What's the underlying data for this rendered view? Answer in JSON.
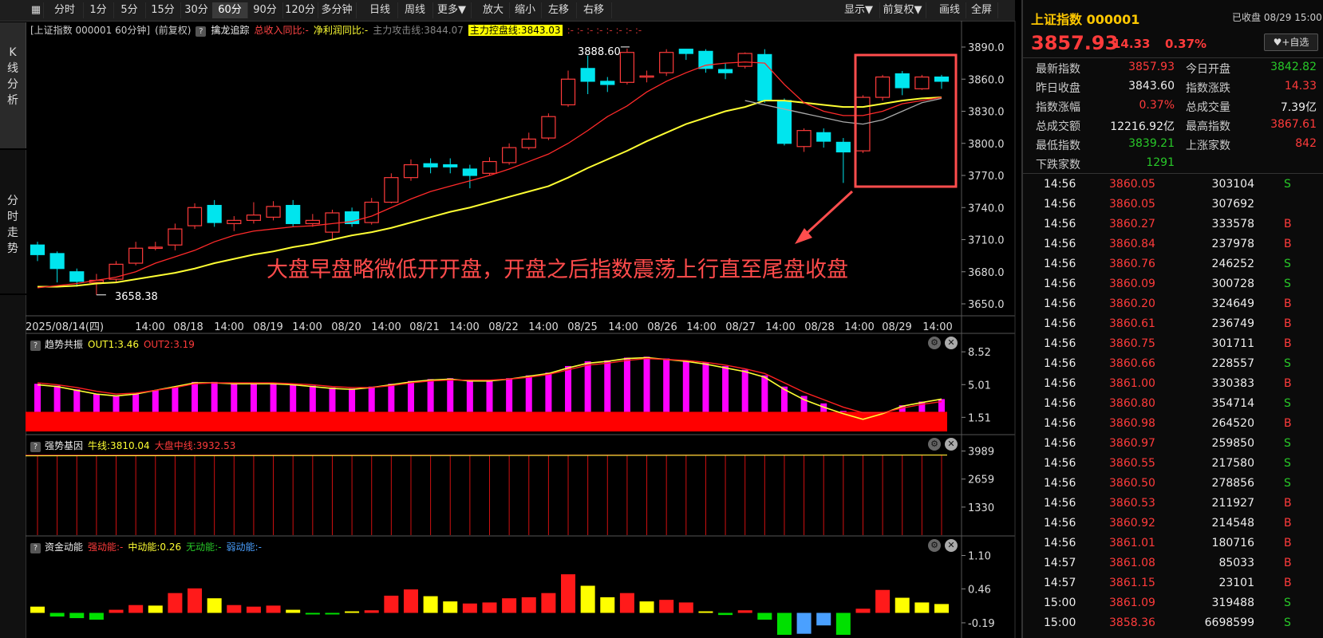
{
  "toolbar": {
    "buttons": [
      "分时",
      "1分",
      "5分",
      "15分",
      "30分",
      "60分",
      "90分",
      "120分",
      "多分钟",
      "日线",
      "周线",
      "更多▼",
      "放大",
      "缩小",
      "左移",
      "右移"
    ],
    "active": "60分",
    "right_buttons": [
      "显示▼",
      "前复权▼",
      "画线",
      "全屏"
    ]
  },
  "left_tabs": {
    "kline": [
      "K",
      "线",
      "分",
      "析"
    ],
    "timeshare": [
      "分",
      "时",
      "走",
      "势"
    ]
  },
  "main_info": {
    "title": "[上证指数 000001 60分钟]",
    "adjust": "(前复权)",
    "indicator": "擒龙追踪",
    "rev_yoy": "总收入同比:-",
    "profit_yoy": "净利润同比:-",
    "attack_line": "主力攻击线:3844.07",
    "control_line": "主力控盘线:3843.03",
    "dashes": ":- :- :- :- :- :- :- :-"
  },
  "price_axis": [
    "3890.0",
    "3860.0",
    "3830.0",
    "3800.0",
    "3770.0",
    "3740.0",
    "3710.0",
    "3680.0",
    "3650.0"
  ],
  "time_axis": [
    "2025/08/14(四)",
    "14:00",
    "08/18",
    "14:00",
    "08/19",
    "14:00",
    "08/20",
    "14:00",
    "08/21",
    "14:00",
    "08/22",
    "14:00",
    "08/25",
    "14:00",
    "08/26",
    "14:00",
    "08/27",
    "14:00",
    "08/28",
    "14:00",
    "08/29",
    "14:00"
  ],
  "annotations": {
    "high_label": "3888.60",
    "low_label": "3658.38",
    "comment": "大盘早盘略微低开开盘，开盘之后指数震荡上行直至尾盘收盘"
  },
  "candles": [
    {
      "o": 3705,
      "c": 3696,
      "h": 3708,
      "l": 3690
    },
    {
      "o": 3697,
      "c": 3683,
      "h": 3699,
      "l": 3670
    },
    {
      "o": 3680,
      "c": 3671,
      "h": 3683,
      "l": 3666
    },
    {
      "o": 3670,
      "c": 3672,
      "h": 3678,
      "l": 3658.38
    },
    {
      "o": 3673,
      "c": 3687,
      "h": 3690,
      "l": 3670
    },
    {
      "o": 3688,
      "c": 3702,
      "h": 3708,
      "l": 3686
    },
    {
      "o": 3702,
      "c": 3703,
      "h": 3708,
      "l": 3700
    },
    {
      "o": 3705,
      "c": 3720,
      "h": 3725,
      "l": 3700
    },
    {
      "o": 3723,
      "c": 3740,
      "h": 3744,
      "l": 3720
    },
    {
      "o": 3742,
      "c": 3726,
      "h": 3747,
      "l": 3722
    },
    {
      "o": 3725,
      "c": 3728,
      "h": 3732,
      "l": 3718
    },
    {
      "o": 3728,
      "c": 3733,
      "h": 3745,
      "l": 3725
    },
    {
      "o": 3731,
      "c": 3741,
      "h": 3746,
      "l": 3728
    },
    {
      "o": 3742,
      "c": 3725,
      "h": 3747,
      "l": 3722
    },
    {
      "o": 3725,
      "c": 3728,
      "h": 3734,
      "l": 3722
    },
    {
      "o": 3717,
      "c": 3735,
      "h": 3738,
      "l": 3710
    },
    {
      "o": 3736,
      "c": 3725,
      "h": 3740,
      "l": 3722
    },
    {
      "o": 3726,
      "c": 3745,
      "h": 3749,
      "l": 3724
    },
    {
      "o": 3745,
      "c": 3768,
      "h": 3772,
      "l": 3744
    },
    {
      "o": 3768,
      "c": 3780,
      "h": 3785,
      "l": 3765
    },
    {
      "o": 3781,
      "c": 3778,
      "h": 3786,
      "l": 3772
    },
    {
      "o": 3780,
      "c": 3778,
      "h": 3786,
      "l": 3772
    },
    {
      "o": 3776,
      "c": 3770,
      "h": 3780,
      "l": 3758
    },
    {
      "o": 3772,
      "c": 3783,
      "h": 3787,
      "l": 3770
    },
    {
      "o": 3782,
      "c": 3796,
      "h": 3800,
      "l": 3780
    },
    {
      "o": 3796,
      "c": 3804,
      "h": 3810,
      "l": 3794
    },
    {
      "o": 3805,
      "c": 3825,
      "h": 3828,
      "l": 3803
    },
    {
      "o": 3836,
      "c": 3860,
      "h": 3868,
      "l": 3834
    },
    {
      "o": 3870,
      "c": 3858,
      "h": 3882,
      "l": 3846
    },
    {
      "o": 3858,
      "c": 3855,
      "h": 3862,
      "l": 3848
    },
    {
      "o": 3857,
      "c": 3885,
      "h": 3888.6,
      "l": 3855
    },
    {
      "o": 3863,
      "c": 3863,
      "h": 3868,
      "l": 3857
    },
    {
      "o": 3866,
      "c": 3885,
      "h": 3888,
      "l": 3863
    },
    {
      "o": 3888,
      "c": 3884,
      "h": 3888,
      "l": 3878
    },
    {
      "o": 3886,
      "c": 3870,
      "h": 3888,
      "l": 3866
    },
    {
      "o": 3869,
      "c": 3866,
      "h": 3875,
      "l": 3860
    },
    {
      "o": 3872,
      "c": 3884,
      "h": 3885,
      "l": 3870
    },
    {
      "o": 3883,
      "c": 3840,
      "h": 3888,
      "l": 3838
    },
    {
      "o": 3840,
      "c": 3800,
      "h": 3842,
      "l": 3798
    },
    {
      "o": 3797,
      "c": 3812,
      "h": 3814,
      "l": 3792
    },
    {
      "o": 3810,
      "c": 3802,
      "h": 3814,
      "l": 3796
    },
    {
      "o": 3801,
      "c": 3792,
      "h": 3805,
      "l": 3763
    },
    {
      "o": 3793,
      "c": 3843,
      "h": 3845,
      "l": 3791
    },
    {
      "o": 3843,
      "c": 3862,
      "h": 3864,
      "l": 3840
    },
    {
      "o": 3865,
      "c": 3852,
      "h": 3867.61,
      "l": 3845
    },
    {
      "o": 3851,
      "c": 3862,
      "h": 3864,
      "l": 3850
    },
    {
      "o": 3862,
      "c": 3858,
      "h": 3864,
      "l": 3851
    }
  ],
  "ma_red": [
    3665,
    3667,
    3669,
    3672,
    3675,
    3680,
    3688,
    3694,
    3700,
    3708,
    3714,
    3718,
    3720,
    3722,
    3723,
    3725,
    3727,
    3732,
    3740,
    3748,
    3755,
    3760,
    3765,
    3770,
    3776,
    3783,
    3790,
    3800,
    3812,
    3825,
    3835,
    3848,
    3858,
    3866,
    3873,
    3875,
    3876,
    3875,
    3855,
    3838,
    3830,
    3826,
    3826,
    3830,
    3837,
    3840,
    3843
  ],
  "ma_yellow": [
    3666,
    3666,
    3667,
    3669,
    3670,
    3673,
    3676,
    3679,
    3683,
    3688,
    3692,
    3696,
    3699,
    3703,
    3706,
    3710,
    3714,
    3717,
    3721,
    3726,
    3731,
    3736,
    3740,
    3745,
    3750,
    3755,
    3760,
    3768,
    3777,
    3785,
    3793,
    3802,
    3810,
    3818,
    3824,
    3830,
    3834,
    3840,
    3840,
    3838,
    3836,
    3834,
    3834,
    3837,
    3840,
    3842,
    3843
  ],
  "ma_grey": [
    3840,
    3836,
    3832,
    3828,
    3824,
    3820,
    3818,
    3822,
    3830,
    3838,
    3842
  ],
  "sub1": {
    "title": "趋势共振",
    "out1": "OUT1:3.46",
    "out2": "OUT2:3.19",
    "axis": [
      "8.52",
      "5.01",
      "1.51"
    ],
    "bars": [
      5.1,
      4.9,
      4.5,
      4.0,
      3.8,
      4.0,
      4.4,
      4.8,
      5.3,
      5.3,
      5.2,
      5.2,
      5.2,
      5.1,
      4.9,
      4.7,
      4.6,
      4.8,
      5.1,
      5.4,
      5.6,
      5.7,
      5.5,
      5.5,
      5.7,
      6.0,
      6.3,
      7.0,
      7.5,
      7.6,
      7.9,
      8.0,
      7.8,
      7.6,
      7.4,
      7.0,
      6.6,
      6.0,
      4.8,
      3.8,
      3.0,
      2.2,
      1.7,
      1.8,
      2.8,
      3.2,
      3.46
    ],
    "out1_line": [
      5.0,
      4.8,
      4.4,
      4.0,
      3.8,
      4.0,
      4.4,
      4.8,
      5.2,
      5.2,
      5.1,
      5.1,
      5.1,
      5.0,
      4.8,
      4.6,
      4.5,
      4.7,
      5.0,
      5.3,
      5.5,
      5.6,
      5.4,
      5.4,
      5.6,
      5.9,
      6.2,
      6.8,
      7.3,
      7.5,
      7.8,
      7.9,
      7.7,
      7.5,
      7.2,
      6.8,
      6.4,
      5.8,
      4.5,
      3.4,
      2.6,
      1.9,
      1.3,
      1.9,
      2.7,
      3.1,
      3.46
    ],
    "out2_line": [
      5.2,
      5.0,
      4.7,
      4.3,
      4.0,
      4.1,
      4.4,
      4.7,
      5.1,
      5.2,
      5.2,
      5.2,
      5.2,
      5.1,
      5.0,
      4.8,
      4.7,
      4.7,
      4.9,
      5.2,
      5.4,
      5.5,
      5.5,
      5.5,
      5.6,
      5.8,
      6.1,
      6.6,
      7.1,
      7.3,
      7.6,
      7.8,
      7.7,
      7.6,
      7.4,
      7.1,
      6.7,
      6.2,
      5.2,
      4.2,
      3.4,
      2.6,
      2.0,
      2.0,
      2.5,
      2.9,
      3.19
    ]
  },
  "sub2": {
    "title": "强势基因",
    "bull": "牛线:3810.04",
    "mid": "大盘中线:3932.53",
    "axis": [
      "3989",
      "2659",
      "1330"
    ]
  },
  "sub3": {
    "title": "资金动能",
    "strong": "强动能:-",
    "medium": "中动能:0.26",
    "none": "无动能:-",
    "weak": "弱动能:-",
    "axis": [
      "1.10",
      "0.46",
      "-0.19"
    ],
    "bars": [
      {
        "v": 0.12,
        "c": "y"
      },
      {
        "v": -0.07,
        "c": "g"
      },
      {
        "v": -0.1,
        "c": "g"
      },
      {
        "v": -0.13,
        "c": "g"
      },
      {
        "v": 0.06,
        "c": "r"
      },
      {
        "v": 0.15,
        "c": "r"
      },
      {
        "v": 0.14,
        "c": "y"
      },
      {
        "v": 0.38,
        "c": "r"
      },
      {
        "v": 0.47,
        "c": "r"
      },
      {
        "v": 0.28,
        "c": "y"
      },
      {
        "v": 0.15,
        "c": "r"
      },
      {
        "v": 0.12,
        "c": "r"
      },
      {
        "v": 0.14,
        "c": "r"
      },
      {
        "v": 0.06,
        "c": "y"
      },
      {
        "v": -0.03,
        "c": "g"
      },
      {
        "v": -0.03,
        "c": "g"
      },
      {
        "v": 0.03,
        "c": "y"
      },
      {
        "v": 0.05,
        "c": "r"
      },
      {
        "v": 0.33,
        "c": "r"
      },
      {
        "v": 0.45,
        "c": "r"
      },
      {
        "v": 0.32,
        "c": "y"
      },
      {
        "v": 0.22,
        "c": "y"
      },
      {
        "v": 0.18,
        "c": "r"
      },
      {
        "v": 0.2,
        "c": "r"
      },
      {
        "v": 0.28,
        "c": "r"
      },
      {
        "v": 0.3,
        "c": "r"
      },
      {
        "v": 0.38,
        "c": "r"
      },
      {
        "v": 0.74,
        "c": "r"
      },
      {
        "v": 0.52,
        "c": "y"
      },
      {
        "v": 0.3,
        "c": "y"
      },
      {
        "v": 0.38,
        "c": "r"
      },
      {
        "v": 0.22,
        "c": "y"
      },
      {
        "v": 0.25,
        "c": "r"
      },
      {
        "v": 0.2,
        "c": "r"
      },
      {
        "v": 0.03,
        "c": "y"
      },
      {
        "v": -0.04,
        "c": "g"
      },
      {
        "v": 0.05,
        "c": "r"
      },
      {
        "v": -0.13,
        "c": "g"
      },
      {
        "v": -0.42,
        "c": "g"
      },
      {
        "v": -0.4,
        "c": "b"
      },
      {
        "v": -0.24,
        "c": "b"
      },
      {
        "v": -0.42,
        "c": "g"
      },
      {
        "v": 0.08,
        "c": "r"
      },
      {
        "v": 0.44,
        "c": "r"
      },
      {
        "v": 0.29,
        "c": "y"
      },
      {
        "v": 0.2,
        "c": "y"
      },
      {
        "v": 0.17,
        "c": "y"
      }
    ]
  },
  "quote": {
    "title": "上证指数 000001",
    "status": "已收盘 08/29 15:00",
    "price": "3857.93",
    "change": "14.33",
    "pct": "0.37%",
    "fav": "♥+自选",
    "fields": [
      {
        "k": "最新指数",
        "v": "3857.93",
        "c": "red"
      },
      {
        "k": "今日开盘",
        "v": "3842.82",
        "c": "green"
      },
      {
        "k": "昨日收盘",
        "v": "3843.60",
        "c": "white"
      },
      {
        "k": "指数涨跌",
        "v": "14.33",
        "c": "red"
      },
      {
        "k": "指数涨幅",
        "v": "0.37%",
        "c": "red"
      },
      {
        "k": "总成交量",
        "v": "7.39亿",
        "c": "white"
      },
      {
        "k": "总成交额",
        "v": "12216.92亿",
        "c": "white"
      },
      {
        "k": "最高指数",
        "v": "3867.61",
        "c": "red"
      },
      {
        "k": "最低指数",
        "v": "3839.21",
        "c": "green"
      },
      {
        "k": "上涨家数",
        "v": "842",
        "c": "red"
      },
      {
        "k": "下跌家数",
        "v": "1291",
        "c": "green"
      }
    ]
  },
  "ticks": [
    [
      "14:56",
      "3860.05",
      "303104",
      "S"
    ],
    [
      "14:56",
      "3860.05",
      "307692",
      ""
    ],
    [
      "14:56",
      "3860.27",
      "333578",
      "B"
    ],
    [
      "14:56",
      "3860.84",
      "237978",
      "B"
    ],
    [
      "14:56",
      "3860.76",
      "246252",
      "S"
    ],
    [
      "14:56",
      "3860.09",
      "300728",
      "S"
    ],
    [
      "14:56",
      "3860.20",
      "324649",
      "B"
    ],
    [
      "14:56",
      "3860.61",
      "236749",
      "B"
    ],
    [
      "14:56",
      "3860.75",
      "301711",
      "B"
    ],
    [
      "14:56",
      "3860.66",
      "228557",
      "S"
    ],
    [
      "14:56",
      "3861.00",
      "330383",
      "B"
    ],
    [
      "14:56",
      "3860.80",
      "354714",
      "S"
    ],
    [
      "14:56",
      "3860.98",
      "264520",
      "B"
    ],
    [
      "14:56",
      "3860.97",
      "259850",
      "S"
    ],
    [
      "14:56",
      "3860.55",
      "217580",
      "S"
    ],
    [
      "14:56",
      "3860.50",
      "278856",
      "S"
    ],
    [
      "14:56",
      "3860.53",
      "211927",
      "B"
    ],
    [
      "14:56",
      "3860.92",
      "214548",
      "B"
    ],
    [
      "14:56",
      "3861.01",
      "180716",
      "B"
    ],
    [
      "14:57",
      "3861.08",
      "85033",
      "B"
    ],
    [
      "14:57",
      "3861.15",
      "23101",
      "B"
    ],
    [
      "15:00",
      "3861.09",
      "319488",
      "S"
    ],
    [
      "15:00",
      "3858.36",
      "6698599",
      "S"
    ]
  ],
  "colors": {
    "up": "#ff3b3b",
    "down": "#00e5ee",
    "yellow": "#ffff33",
    "magenta": "#ff00ff",
    "red_fill": "#ff0000",
    "highlight": "#ff4d4d"
  }
}
